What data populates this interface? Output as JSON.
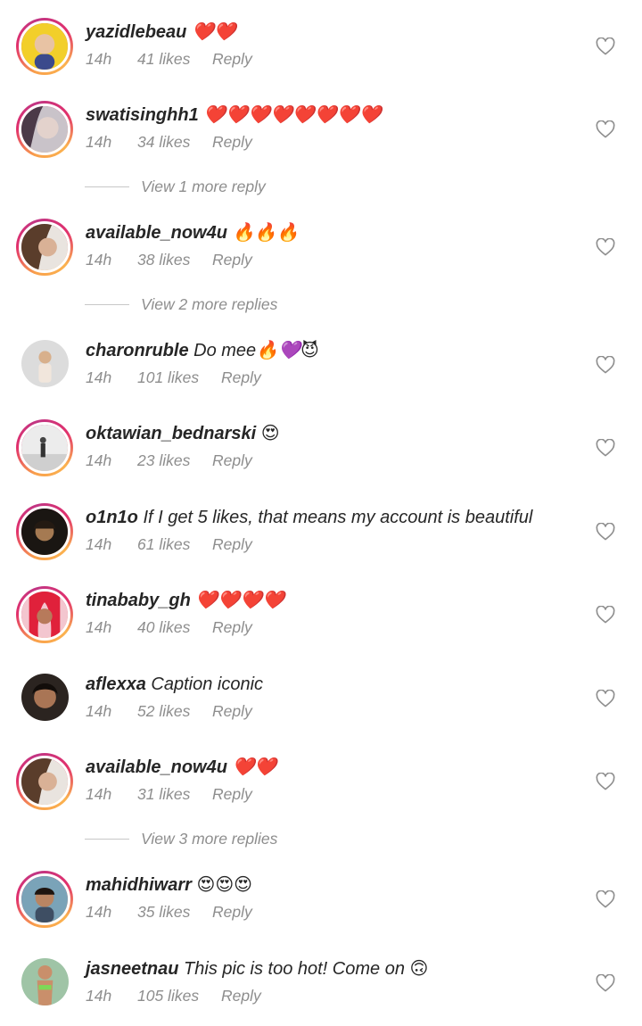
{
  "comments": [
    {
      "username": "yazidlebeau",
      "text": "❤️❤️",
      "time": "14h",
      "likes": "41 likes",
      "reply": "Reply"
    },
    {
      "username": "swatisinghh1",
      "text": "❤️❤️❤️❤️❤️❤️❤️❤️",
      "time": "14h",
      "likes": "34 likes",
      "reply": "Reply"
    },
    {
      "username": "available_now4u",
      "text": "🔥🔥🔥",
      "time": "14h",
      "likes": "38 likes",
      "reply": "Reply"
    },
    {
      "username": "charonruble",
      "text": "Do mee🔥💜😈",
      "time": "14h",
      "likes": "101 likes",
      "reply": "Reply"
    },
    {
      "username": "oktawian_bednarski",
      "text": "😍",
      "time": "14h",
      "likes": "23 likes",
      "reply": "Reply"
    },
    {
      "username": "o1n1o",
      "text": "If I get 5 likes, that means my account is beautiful",
      "time": "14h",
      "likes": "61 likes",
      "reply": "Reply"
    },
    {
      "username": "tinababy_gh",
      "text": "❤️❤️❤️❤️",
      "time": "14h",
      "likes": "40 likes",
      "reply": "Reply"
    },
    {
      "username": "aflexxa",
      "text": "Caption iconic",
      "time": "14h",
      "likes": "52 likes",
      "reply": "Reply"
    },
    {
      "username": "available_now4u",
      "text": "❤️❤️",
      "time": "14h",
      "likes": "31 likes",
      "reply": "Reply"
    },
    {
      "username": "mahidhiwarr",
      "text": "😍😍😍",
      "time": "14h",
      "likes": "35 likes",
      "reply": "Reply"
    },
    {
      "username": "jasneetnau",
      "text": "This pic is too hot! Come on 🙃",
      "time": "14h",
      "likes": "105 likes",
      "reply": "Reply"
    }
  ],
  "more_replies": {
    "after_swatisinghh1": "View 1 more reply",
    "after_available_now4u_1": "View 2 more replies",
    "after_available_now4u_2": "View 3 more replies"
  },
  "icons": {
    "like": "heart-outline-icon",
    "avatar": "user-avatar"
  },
  "colors": {
    "text_primary": "#262626",
    "text_secondary": "#8e8e8e",
    "story_ring": "#e1306c"
  }
}
